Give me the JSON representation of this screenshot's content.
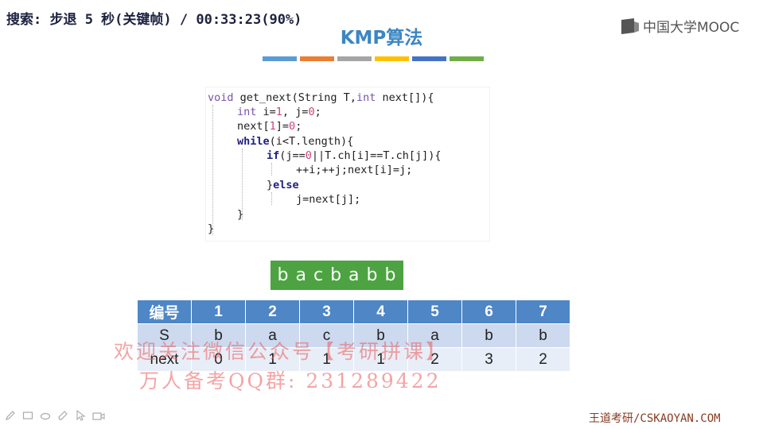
{
  "overlay": {
    "search_status": "搜索: 步退 5 秒(关键帧) / 00:33:23(90%)"
  },
  "branding": {
    "mooc_logo_text": "中国大学MOOC",
    "footer_text": "王道考研/CSKAOYAN.COM"
  },
  "slide": {
    "title": "KMP算法",
    "title_bar_colors": [
      "#5b9bd5",
      "#ed7d31",
      "#a5a5a5",
      "#ffc000",
      "#4472c4",
      "#70ad47"
    ]
  },
  "code": {
    "line1_kw": "void",
    "line1_rest": " get_next(String T,",
    "line1_kw2": "int",
    "line1_end": " next[]){",
    "line2_kw": "int",
    "line2_a": " i=",
    "line2_n1": "1",
    "line2_b": ", j=",
    "line2_n2": "0",
    "line2_c": ";",
    "line3_a": "next[",
    "line3_n1": "1",
    "line3_b": "]=",
    "line3_n2": "0",
    "line3_c": ";",
    "line4_kw": "while",
    "line4_rest": "(i<T.length){",
    "line5_kw": "if",
    "line5_a": "(j==",
    "line5_n": "0",
    "line5_rest": "||T.ch[i]==T.ch[j]){",
    "line6": "++i;++j;next[i]=j;",
    "line7_a": "}",
    "line7_kw": "else",
    "line8": "j=next[j];",
    "line9": "}",
    "line10": "}"
  },
  "pattern": {
    "text": "b a c b a b b"
  },
  "table": {
    "header": [
      "编号",
      "1",
      "2",
      "3",
      "4",
      "5",
      "6",
      "7"
    ],
    "row_s": [
      "S",
      "b",
      "a",
      "c",
      "b",
      "a",
      "b",
      "b"
    ],
    "row_next": [
      "next",
      "0",
      "1",
      "1",
      "1",
      "2",
      "3",
      "2"
    ]
  },
  "watermark": {
    "line1": "欢迎关注微信公众号【考研拼课】",
    "line2": "万人备考QQ群: 231289422"
  },
  "toolbar": {
    "icons": [
      "pen-icon",
      "slide-icon",
      "eraser-icon",
      "highlighter-icon",
      "pointer-icon",
      "camera-icon"
    ]
  }
}
